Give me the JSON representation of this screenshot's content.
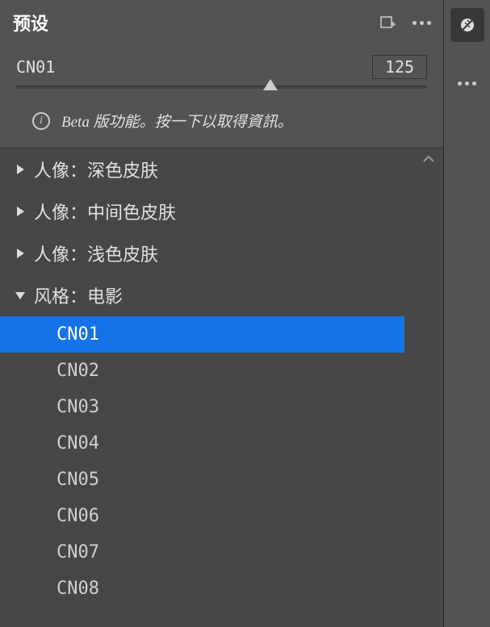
{
  "header": {
    "title": "预设"
  },
  "controls": {
    "preset_name": "CN01",
    "value": "125"
  },
  "beta": {
    "text": "Beta 版功能。按一下以取得資訊。"
  },
  "tree": {
    "groups": [
      {
        "label": "人像：深色皮肤",
        "expanded": false
      },
      {
        "label": "人像：中间色皮肤",
        "expanded": false
      },
      {
        "label": "人像：浅色皮肤",
        "expanded": false
      },
      {
        "label": "风格：电影",
        "expanded": true
      }
    ],
    "children": [
      {
        "label": "CN01",
        "selected": true
      },
      {
        "label": "CN02",
        "selected": false
      },
      {
        "label": "CN03",
        "selected": false
      },
      {
        "label": "CN04",
        "selected": false
      },
      {
        "label": "CN05",
        "selected": false
      },
      {
        "label": "CN06",
        "selected": false
      },
      {
        "label": "CN07",
        "selected": false
      },
      {
        "label": "CN08",
        "selected": false
      }
    ]
  }
}
